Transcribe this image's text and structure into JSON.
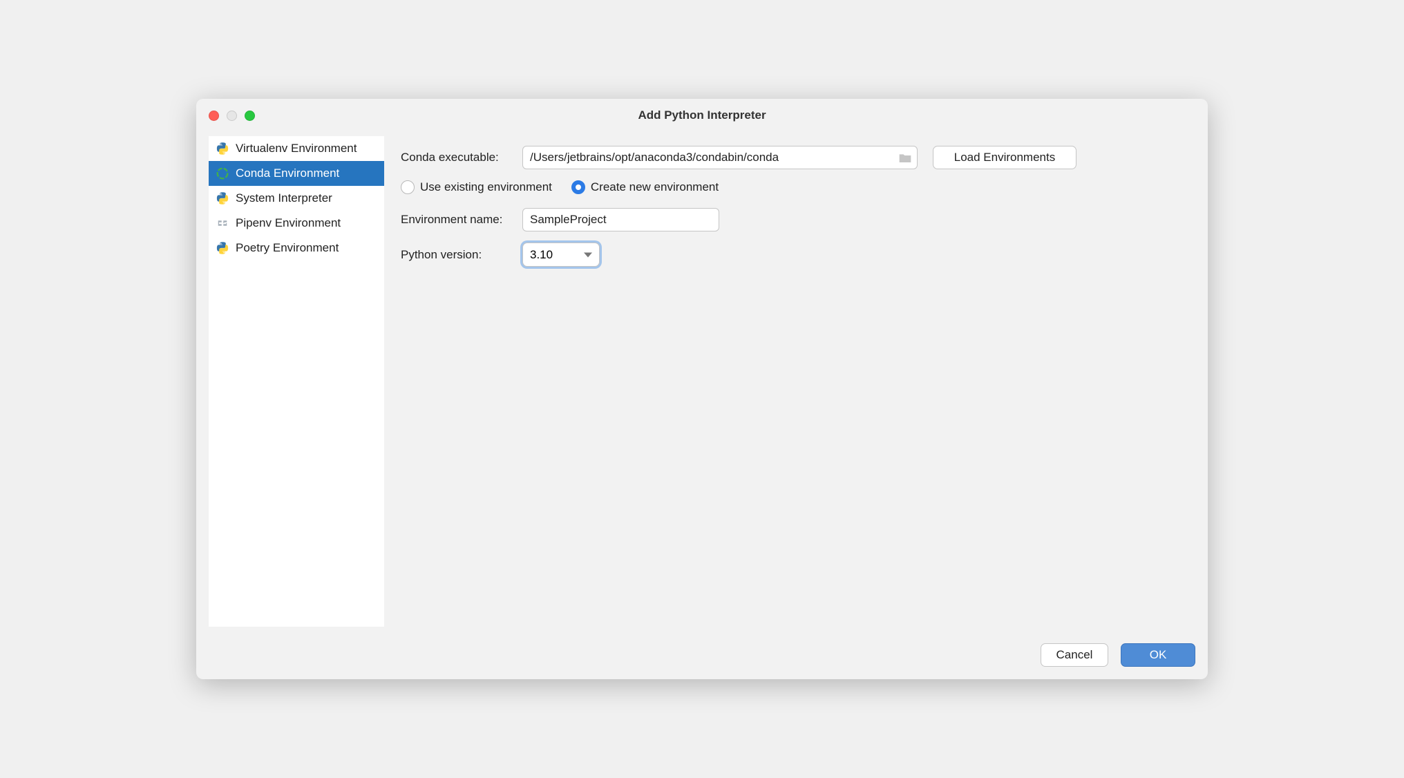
{
  "window": {
    "title": "Add Python Interpreter"
  },
  "sidebar": {
    "items": [
      {
        "label": "Virtualenv Environment",
        "icon": "python"
      },
      {
        "label": "Conda Environment",
        "icon": "conda",
        "selected": true
      },
      {
        "label": "System Interpreter",
        "icon": "python"
      },
      {
        "label": "Pipenv Environment",
        "icon": "pipenv"
      },
      {
        "label": "Poetry Environment",
        "icon": "python"
      }
    ]
  },
  "form": {
    "conda_exec_label": "Conda executable:",
    "conda_exec_value": "/Users/jetbrains/opt/anaconda3/condabin/conda",
    "load_env_label": "Load Environments",
    "radio_use_existing": "Use existing environment",
    "radio_create_new": "Create new environment",
    "env_name_label": "Environment name:",
    "env_name_value": "SampleProject",
    "py_version_label": "Python version:",
    "py_version_value": "3.10"
  },
  "footer": {
    "cancel": "Cancel",
    "ok": "OK"
  }
}
